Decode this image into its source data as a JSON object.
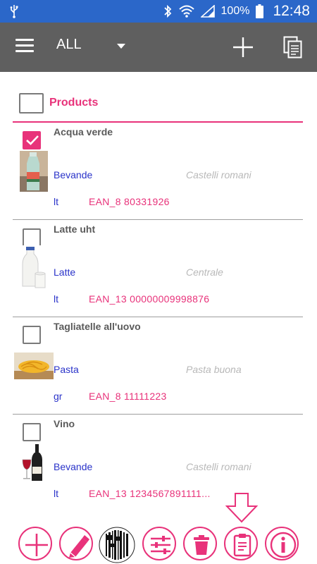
{
  "status_bar": {
    "battery": "100%",
    "time": "12:48",
    "icons": [
      "usb-icon",
      "bluetooth-icon",
      "wifi-icon",
      "signal-icon",
      "battery-icon"
    ]
  },
  "app_bar": {
    "filter_value": "ALL",
    "icons": [
      "menu-icon",
      "dropdown-arrow-icon",
      "add-icon",
      "copy-icon"
    ]
  },
  "list": {
    "header_title": "Products",
    "products": [
      {
        "name": "Acqua verde",
        "category": "Bevande",
        "brand": "Castelli romani",
        "unit": "lt",
        "code": "EAN_8 80331926",
        "checked": true,
        "image": "water-bottle-image"
      },
      {
        "name": "Latte uht",
        "category": "Latte",
        "brand": "Centrale",
        "unit": "lt",
        "code": "EAN_13 00000009998876",
        "checked": false,
        "image": "milk-image"
      },
      {
        "name": "Tagliatelle all'uovo",
        "category": "Pasta",
        "brand": "Pasta buona",
        "unit": "gr",
        "code": "EAN_8 11111223",
        "checked": false,
        "image": "pasta-image"
      },
      {
        "name": "Vino",
        "category": "Bevande",
        "brand": "Castelli romani",
        "unit": "lt",
        "code": "EAN_13 1234567891111...",
        "checked": false,
        "image": "wine-image"
      }
    ]
  },
  "toolbar": {
    "buttons": [
      "add-icon",
      "edit-pencil-icon",
      "barcode-icon",
      "sliders-icon",
      "trash-icon",
      "clipboard-icon",
      "info-icon"
    ],
    "hint": "down-arrow-icon"
  },
  "colors": {
    "status_bar": "#2b67c9",
    "app_bar": "#5f5f5f",
    "accent": "#e8327a",
    "category_text": "#2a33c9",
    "brand_text": "#b8b8b8"
  }
}
